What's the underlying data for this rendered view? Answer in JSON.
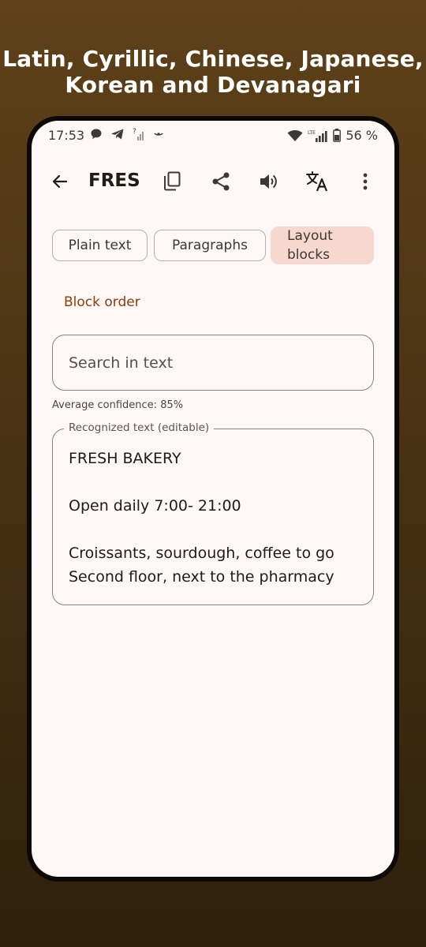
{
  "promo": {
    "headline_line1": "Latin, Cyrillic, Chinese, Japanese,",
    "headline_line2": "Korean and Devanagari"
  },
  "status_bar": {
    "time": "17:53",
    "battery": "56 %",
    "network_label": "LTE"
  },
  "app_bar": {
    "title": "FRES",
    "icons": [
      "back-arrow-icon",
      "copy-icon",
      "share-icon",
      "volume-icon",
      "translate-icon",
      "more-vert-icon"
    ]
  },
  "mode_chips": {
    "plain_text": "Plain text",
    "paragraphs": "Paragraphs",
    "layout_blocks_line1": "Layout",
    "layout_blocks_line2": "blocks",
    "selected": "Layout blocks"
  },
  "block_order_label": "Block order",
  "search": {
    "placeholder": "Search in text",
    "value": ""
  },
  "confidence_text": "Average confidence: 85%",
  "recognized": {
    "label": "Recognized text (editable)",
    "text": "FRESH BAKERY\n\nOpen daily 7:00- 21:00\n\nCroissants, sourdough, coffee to go\nSecond floor, next to the pharmacy"
  },
  "colors": {
    "accent": "#8f3a0c",
    "selected_chip": "#f6d8cf",
    "surface": "#fdf8f5",
    "background_top": "#5e4118",
    "background_bottom": "#2f200c"
  }
}
